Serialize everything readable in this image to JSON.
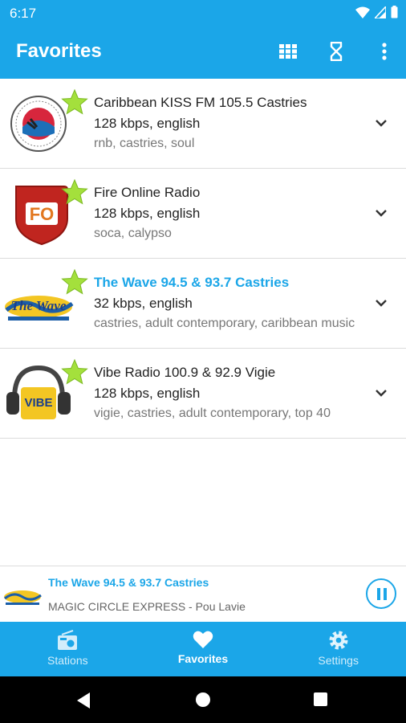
{
  "status_bar": {
    "time": "6:17"
  },
  "app_bar": {
    "title": "Favorites",
    "actions": [
      "grid-view-icon",
      "sleep-timer-icon",
      "more-options-icon"
    ]
  },
  "stations": [
    {
      "name": "Caribbean KISS FM 105.5 Castries",
      "info": "128 kbps, english",
      "tags": "rnb, castries, soul",
      "playing": false,
      "logo": "kiss-fm-logo",
      "favorite": true
    },
    {
      "name": "Fire Online Radio",
      "info": "128 kbps, english",
      "tags": "soca, calypso",
      "playing": false,
      "logo": "fire-online-logo",
      "favorite": true,
      "logo_text": "FO"
    },
    {
      "name": "The Wave 94.5 & 93.7 Castries",
      "info": "32 kbps, english",
      "tags": "castries, adult contemporary, caribbean music",
      "playing": true,
      "logo": "the-wave-logo",
      "favorite": true,
      "logo_text": "The Wave"
    },
    {
      "name": "Vibe Radio 100.9 & 92.9 Vigie",
      "info": "128 kbps, english",
      "tags": "vigie, castries, adult contemporary, top 40",
      "playing": false,
      "logo": "vibe-radio-logo",
      "favorite": true,
      "logo_text": "VIBE"
    }
  ],
  "player": {
    "station": "The Wave 94.5 & 93.7 Castries",
    "track": "MAGIC CIRCLE EXPRESS - Pou Lavie",
    "state": "playing"
  },
  "bottom_nav": [
    {
      "label": "Stations",
      "icon": "radio-icon",
      "active": false
    },
    {
      "label": "Favorites",
      "icon": "heart-icon",
      "active": true
    },
    {
      "label": "Settings",
      "icon": "gear-icon",
      "active": false
    }
  ],
  "colors": {
    "accent": "#1ba6e8",
    "star": "#a4e03c"
  }
}
